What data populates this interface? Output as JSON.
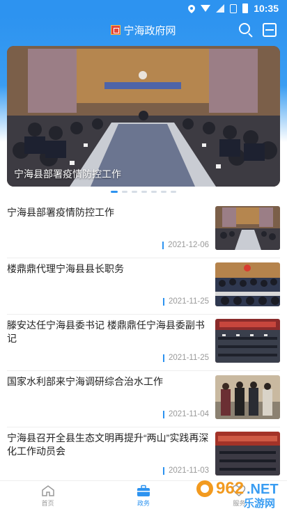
{
  "status_bar": {
    "time": "10:35"
  },
  "header": {
    "app_title": "宁海政府网",
    "search_icon": "search-icon",
    "scan_icon": "scan-icon"
  },
  "banner": {
    "caption": "宁海县部署疫情防控工作",
    "slide_count": 7,
    "active_slide": 1
  },
  "news": [
    {
      "title": "宁海县部署疫情防控工作",
      "date": "2021-12-06"
    },
    {
      "title": "楼鼎鼎代理宁海县县长职务",
      "date": "2021-11-25"
    },
    {
      "title": "滕安达任宁海县委书记 楼鼎鼎任宁海县委副书记",
      "date": "2021-11-25"
    },
    {
      "title": "国家水利部来宁海调研综合治水工作",
      "date": "2021-11-04"
    },
    {
      "title": "宁海县召开全县生态文明再提升“两山”实践再深化工作动员会",
      "date": "2021-11-03"
    }
  ],
  "bottom_nav": [
    {
      "label": "首页",
      "icon": "home-icon"
    },
    {
      "label": "政务",
      "icon": "briefcase-icon",
      "active": true
    },
    {
      "label": "服务",
      "icon": "heart-icon"
    }
  ],
  "watermark": {
    "text_top": "962",
    "text_dot": ".NET",
    "text_bottom": "乐游网"
  },
  "colors": {
    "primary": "#2d93f0",
    "text": "#222222",
    "muted": "#999999"
  }
}
